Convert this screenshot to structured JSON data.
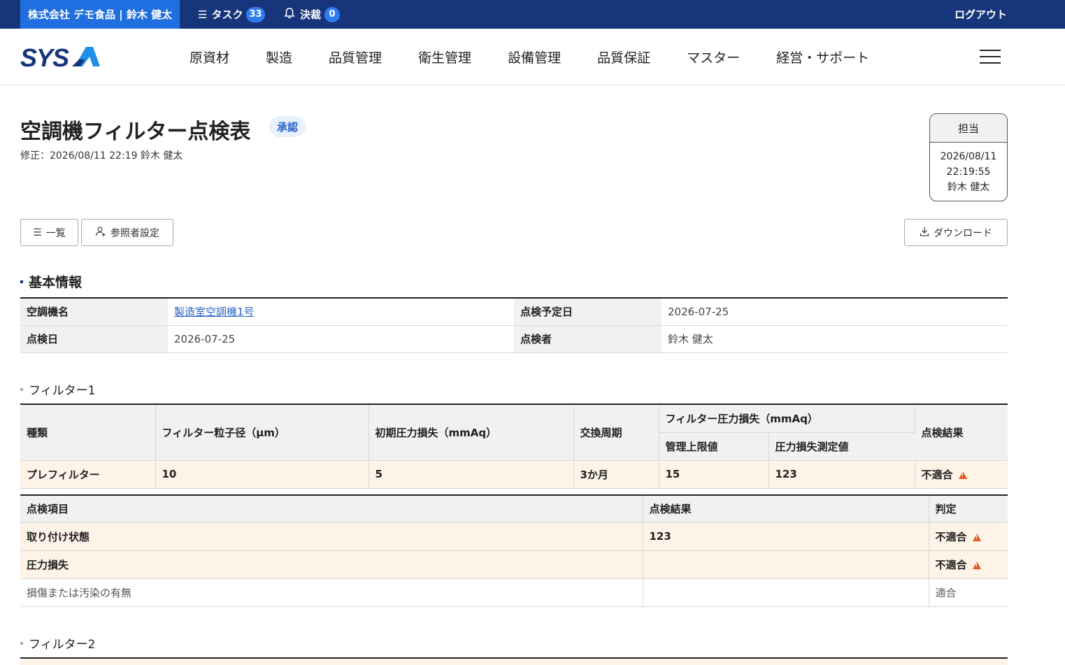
{
  "topbar": {
    "company_user": "株式会社 デモ食品 | 鈴木 健太",
    "tasks_label": "タスク",
    "tasks_count": "33",
    "approvals_label": "決裁",
    "approvals_count": "0",
    "logout": "ログアウト",
    "colors": {
      "bar": "#16357a",
      "company": "#1f6fe0",
      "badge": "#2f7cf0"
    }
  },
  "header": {
    "logo_text": "SYSA",
    "nav": [
      "原資材",
      "製造",
      "品質管理",
      "衛生管理",
      "設備管理",
      "品質保証",
      "マスター",
      "経営・サポート"
    ]
  },
  "page": {
    "title": "空調機フィルター点検表",
    "status": "承認",
    "modified": "修正：2026/08/11 22:19  鈴木 健太"
  },
  "stamp": {
    "label": "担当",
    "date": "2026/08/11",
    "time": "22:19:55",
    "name": "鈴木 健太"
  },
  "buttons": {
    "list": "一覧",
    "viewers": "参照者設定",
    "download": "ダウンロード"
  },
  "basic_info": {
    "heading": "基本情報",
    "rows": [
      {
        "l1": "空調機名",
        "v1": "製造室空調機1号",
        "l2": "点検予定日",
        "v2": "2026-07-25"
      },
      {
        "l1": "点検日",
        "v1": "2026-07-25",
        "l2": "点検者",
        "v2": "鈴木 健太"
      }
    ]
  },
  "filter1": {
    "heading": "フィルター1",
    "headers": {
      "type": "種類",
      "particle": "フィルター粒子径（µm）",
      "initial": "初期圧力損失（mmAq）",
      "cycle": "交換周期",
      "pressure_group": "フィルター圧力損失（mmAq）",
      "limit": "管理上限値",
      "measured": "圧力損失測定値",
      "result": "点検結果"
    },
    "row": {
      "type": "プレフィルター",
      "particle": "10",
      "initial": "5",
      "cycle": "3か月",
      "limit": "15",
      "measured": "123",
      "result": "不適合"
    },
    "items_headers": {
      "item": "点検項目",
      "result": "点検結果",
      "judge": "判定"
    },
    "items": [
      {
        "item": "取り付け状態",
        "result": "123",
        "judge": "不適合"
      },
      {
        "item": "圧力損失",
        "result": "",
        "judge": "不適合"
      },
      {
        "item": "損傷または汚染の有無",
        "result": "",
        "judge": "適合"
      }
    ]
  },
  "filter2": {
    "heading": "フィルター2"
  }
}
